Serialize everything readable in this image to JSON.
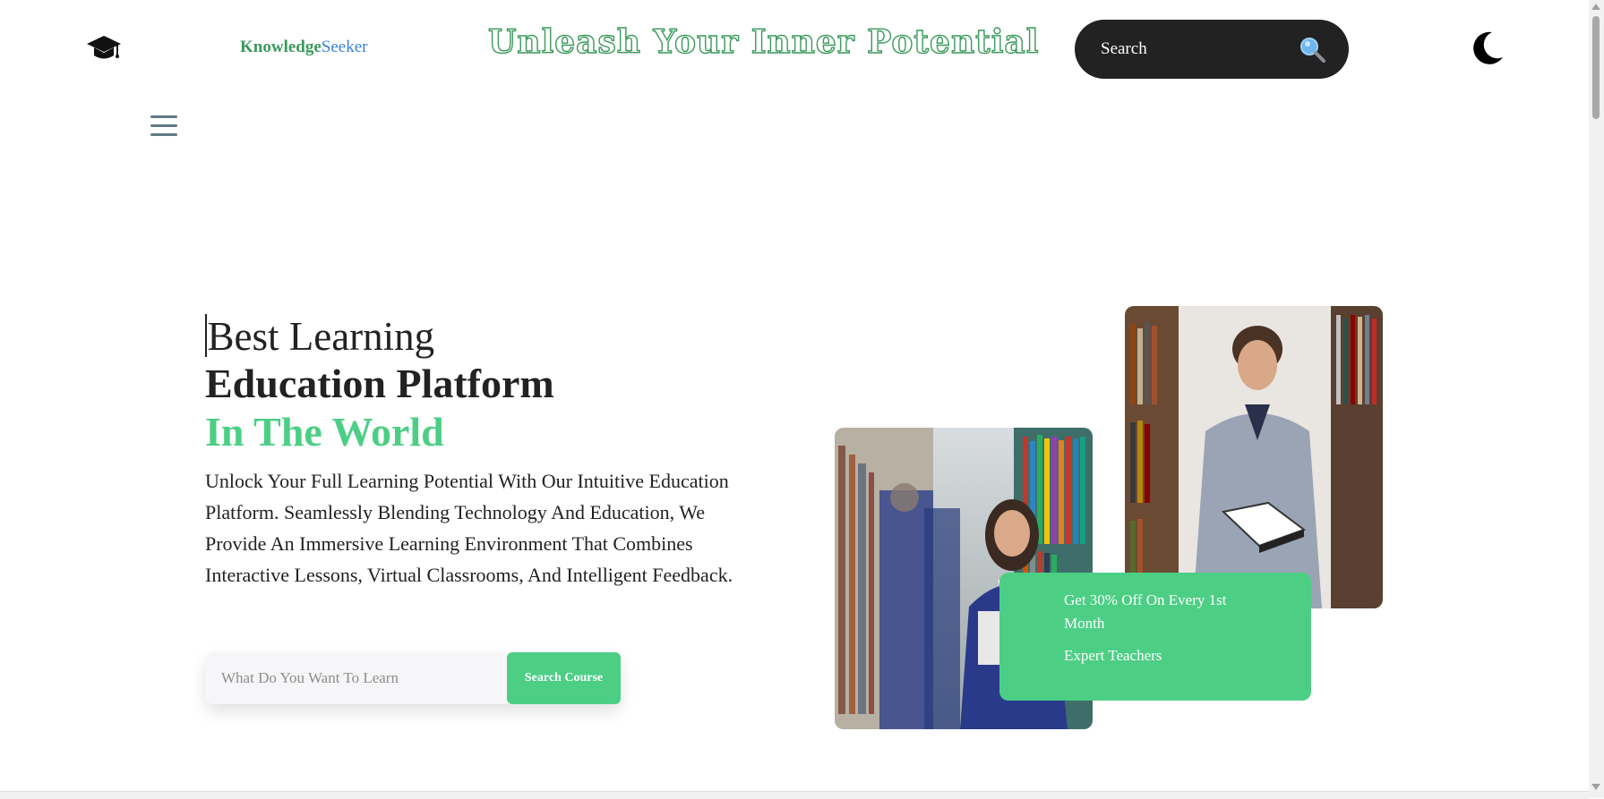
{
  "header": {
    "logo_icon": "graduation-cap-icon",
    "brand_part1": "Knowledge",
    "brand_part2": "Seeker",
    "tagline": "Unleash Your Inner Potential",
    "search_label": "Search",
    "search_icon": "magnifier-icon",
    "theme_toggle_icon": "moon-icon"
  },
  "nav": {
    "menu_icon": "hamburger-menu-icon"
  },
  "hero": {
    "line1": "Best Learning",
    "line2": "Education Platform",
    "line3": "In The World",
    "description": "Unlock Your Full Learning Potential With Our Intuitive Education Platform. Seamlessly Blending Technology And Education, We Provide An Immersive Learning Environment That Combines Interactive Lessons, Virtual Classrooms, And Intelligent Feedback.",
    "course_search_placeholder": "What Do You Want To Learn",
    "course_search_value": "",
    "course_search_button": "Search Course"
  },
  "promo": {
    "offer": "Get 30% Off On Every 1st Month",
    "feature": "Expert Teachers"
  },
  "colors": {
    "accent_green": "#4ccf85",
    "brand_green": "#3a9a5b",
    "brand_blue": "#3b82d6",
    "dark": "#222222"
  }
}
